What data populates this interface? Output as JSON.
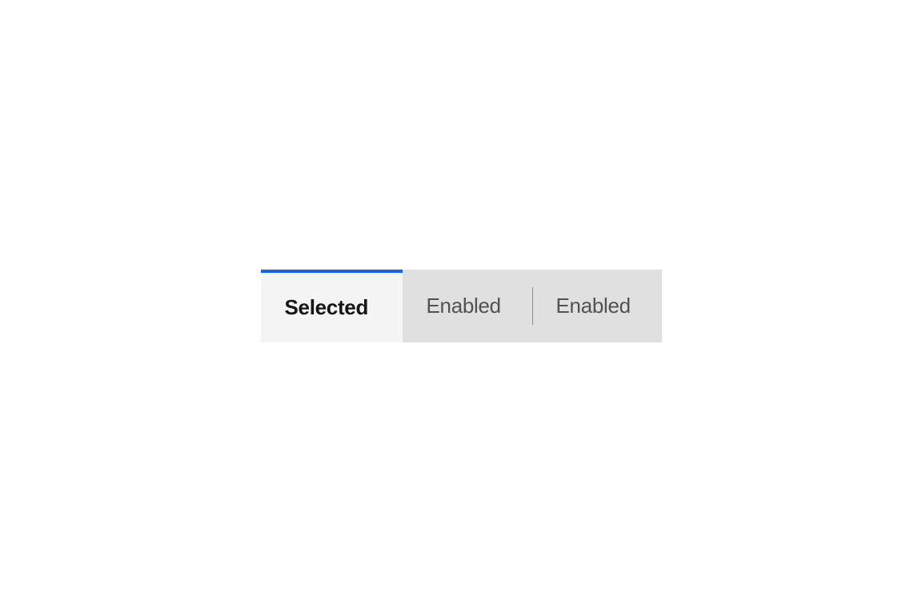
{
  "tabs": [
    {
      "label": "Selected",
      "state": "selected"
    },
    {
      "label": "Enabled",
      "state": "enabled"
    },
    {
      "label": "Enabled",
      "state": "enabled"
    }
  ],
  "colors": {
    "accent": "#0f62fe",
    "selected_bg": "#f4f4f4",
    "enabled_bg": "#e0e0e0",
    "selected_text": "#161616",
    "enabled_text": "#525252"
  }
}
